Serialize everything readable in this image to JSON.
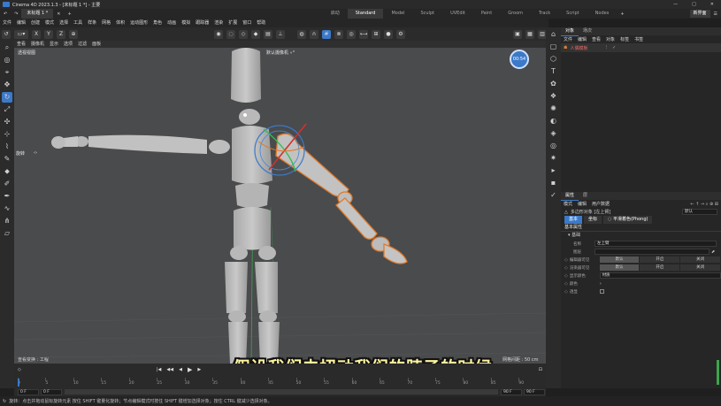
{
  "window": {
    "title": "Cinema 4D 2023.1.3 - [未标题 1 *] - 主要",
    "controls": [
      "—",
      "□",
      "✕"
    ]
  },
  "doc_tab": "未标题 1 *",
  "layout_tabs": [
    "启动",
    "Standard",
    "Model",
    "Sculpt",
    "UVEdit",
    "Paint",
    "Groom",
    "Track",
    "Script",
    "Nodes"
  ],
  "layout_active": "Standard",
  "new_layout": "新界面",
  "menu": [
    "文件",
    "编辑",
    "创建",
    "模式",
    "选择",
    "工具",
    "样条",
    "网格",
    "体积",
    "运动图形",
    "角色",
    "动画",
    "模拟",
    "跟踪器",
    "渲染",
    "扩展",
    "窗口",
    "帮助"
  ],
  "coord_buttons": [
    "X",
    "Y",
    "Z"
  ],
  "viewport": {
    "menu": [
      "查看",
      "摄像机",
      "显示",
      "选项",
      "过滤",
      "面板"
    ],
    "view_name": "透视视图",
    "camera_label": "默认摄像机 ∘°",
    "rotate_label": "旋转",
    "fps_badge": "00:54",
    "grid_spacing_label": "网格间距 : 50 cm",
    "view_transform_label": "查看变换 : 工程"
  },
  "objects_panel": {
    "tabs": [
      "对象",
      "场次"
    ],
    "menu": [
      "文件",
      "编辑",
      "查看",
      "对象",
      "标签",
      "书签"
    ],
    "items": [
      {
        "name": "人偶模板",
        "icon": "figure-icon"
      }
    ]
  },
  "attributes_panel": {
    "tabs": [
      "属性",
      "层"
    ],
    "menu": [
      "模式",
      "编辑",
      "用户数据"
    ],
    "object_label": "多边形对象 [左上臂]",
    "preset_dropdown": "默认",
    "subtabs": [
      "基本",
      "坐标",
      "◌ 平滑着色(Phong)"
    ],
    "section_title": "基本属性",
    "subsection": "▾ 基础",
    "fields": {
      "name_label": "名称",
      "name_value": "左上臂",
      "layer_label": "图层",
      "layer_value": "",
      "editor_visible_label": "编辑器可见",
      "render_visible_label": "渲染器可见",
      "visibility_options": [
        "默认",
        "开启",
        "关闭"
      ],
      "display_color_label": "显示颜色",
      "display_color_value": "材质",
      "color_label": "颜色",
      "color_value": "›",
      "transparent_label": "透显"
    }
  },
  "timeline": {
    "ticks": [
      "0",
      "5",
      "10",
      "15",
      "20",
      "25",
      "30",
      "35",
      "40",
      "45",
      "50",
      "55",
      "60",
      "65",
      "70",
      "75",
      "80",
      "85",
      "90"
    ],
    "start_field": "0 F",
    "current_field": "0 F",
    "end_field": "90 F",
    "end_field2": "90 F"
  },
  "status_text": "旋转：点击并拖动鼠标旋转元素 按住 SHIFT 键量化旋转；节点编辑模式时按住 SHIFT 键增加选择对象；按住 CTRL 键减少选择对象。",
  "subtitle": "假设我们去扭动我们的脖子的时候",
  "colors": {
    "accent": "#3b79c9",
    "selection_outline": "#e07a2a",
    "subtitle_text": "#fff5a0"
  }
}
